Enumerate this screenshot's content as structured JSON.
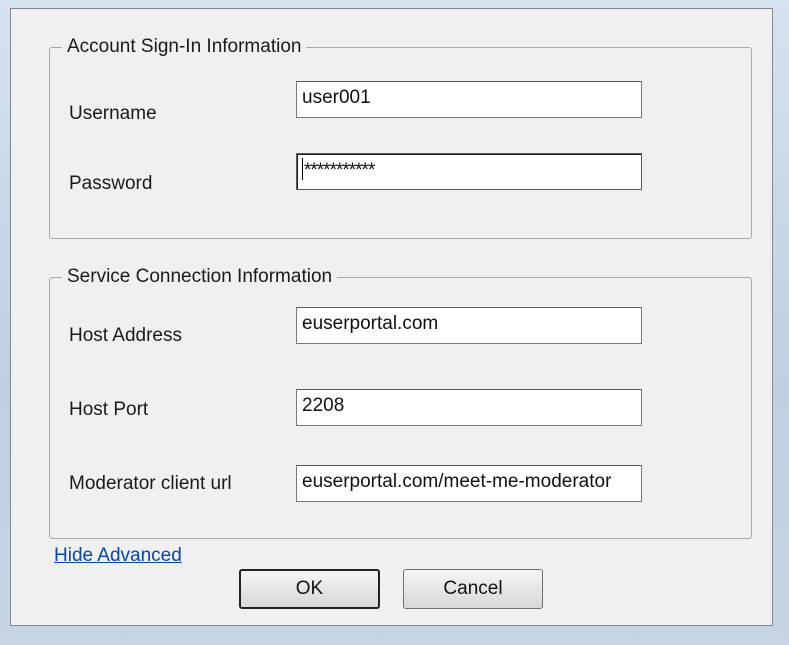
{
  "account_group": {
    "title": "Account Sign-In Information",
    "username_label": "Username",
    "username_value": "user001",
    "password_label": "Password",
    "password_value": "***********"
  },
  "service_group": {
    "title": "Service Connection Information",
    "host_address_label": "Host Address",
    "host_address_value": "euserportal.com",
    "host_port_label": "Host Port",
    "host_port_value": "2208",
    "moderator_label": "Moderator client url",
    "moderator_value": "euserportal.com/meet-me-moderator"
  },
  "links": {
    "toggle_advanced": "Hide Advanced"
  },
  "buttons": {
    "ok": "OK",
    "cancel": "Cancel"
  },
  "colors": {
    "link": "#0645ad",
    "dialog_background": "#f0f0f0"
  }
}
